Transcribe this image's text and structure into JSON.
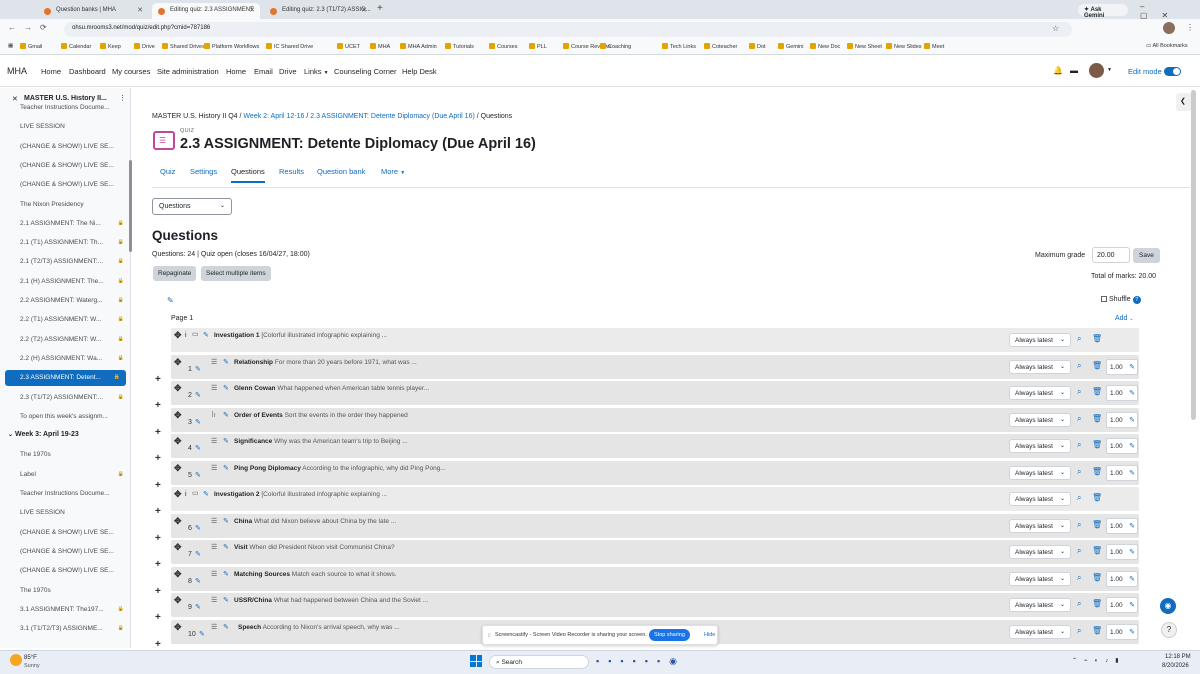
{
  "browser": {
    "tabs": [
      {
        "label": "Question banks | MHA"
      },
      {
        "label": "Editing quiz: 2.3 ASSIGNMENT"
      },
      {
        "label": "Editing quiz: 2.3 (T1/T2) ASSIG..."
      }
    ],
    "ask_gemini": "Ask Gemini",
    "url": "ohsu.mrooms3.net/mod/quiz/edit.php?cmid=787186",
    "bookmarks": [
      "Gmail",
      "Calendar",
      "Keep",
      "Drive",
      "Shared Drives",
      "Platform Workflows",
      "IC Shared Drive",
      "UCET",
      "MHA",
      "MHA Admin",
      "Tutorials",
      "Courses",
      "PLL",
      "Course Reviews",
      "Coaching",
      "Tech Links",
      "Coteacher",
      "Dot",
      "Gemini",
      "New Doc",
      "New Sheet",
      "New Slides",
      "Meet"
    ],
    "all_bookmarks": "All Bookmarks"
  },
  "nav": {
    "brand": "MHA",
    "items": [
      "Home",
      "Dashboard",
      "My courses",
      "Site administration",
      "Home",
      "Email",
      "Drive",
      "Links",
      "Counseling Corner",
      "Help Desk"
    ],
    "edit_mode": "Edit mode"
  },
  "drawer": {
    "course_title": "MASTER U.S. History II...",
    "items": [
      {
        "label": "Teacher Instructions Docume...",
        "lock": false
      },
      {
        "label": "LIVE SESSION",
        "lock": false
      },
      {
        "label": "(CHANGE & SHOW!) LIVE SE...",
        "lock": false
      },
      {
        "label": "(CHANGE & SHOW!) LIVE SE...",
        "lock": false
      },
      {
        "label": "(CHANGE & SHOW!) LIVE SE...",
        "lock": false
      },
      {
        "label": "The Nixon Presidency",
        "lock": false
      },
      {
        "label": "2.1 ASSIGNMENT: The Ni...",
        "lock": true
      },
      {
        "label": "2.1 (T1) ASSIGNMENT: Th...",
        "lock": true
      },
      {
        "label": "2.1 (T2/T3) ASSIGNMENT:...",
        "lock": true
      },
      {
        "label": "2.1 (H) ASSIGNMENT: The...",
        "lock": true
      },
      {
        "label": "2.2 ASSIGNMENT: Waterg...",
        "lock": true
      },
      {
        "label": "2.2 (T1) ASSIGNMENT: W...",
        "lock": true
      },
      {
        "label": "2.2 (T2) ASSIGNMENT: W...",
        "lock": true
      },
      {
        "label": "2.2 (H) ASSIGNMENT: Wa...",
        "lock": true
      },
      {
        "label": "2.3 ASSIGNMENT: Detent...",
        "lock": true,
        "active": true
      },
      {
        "label": "2.3 (T1/T2) ASSIGNMENT:...",
        "lock": true
      },
      {
        "label": "To open this week's assignm...",
        "lock": false
      }
    ],
    "section": "Week 3: April 19-23",
    "items2": [
      {
        "label": "The 1970s",
        "lock": false
      },
      {
        "label": "Label",
        "lock": true
      },
      {
        "label": "Teacher Instructions Docume...",
        "lock": false
      },
      {
        "label": "LIVE SESSION",
        "lock": false
      },
      {
        "label": "(CHANGE & SHOW!) LIVE SE...",
        "lock": false
      },
      {
        "label": "(CHANGE & SHOW!) LIVE SE...",
        "lock": false
      },
      {
        "label": "(CHANGE & SHOW!) LIVE SE...",
        "lock": false
      },
      {
        "label": "The 1970s",
        "lock": false
      },
      {
        "label": "3.1 ASSIGNMENT: The197...",
        "lock": true
      },
      {
        "label": "3.1 (T1/T2/T3) ASSIGNME...",
        "lock": true
      }
    ]
  },
  "breadcrumb": [
    "MASTER U.S. History II Q4",
    "Week 2: April 12-16",
    "2.3 ASSIGNMENT: Detente Diplomacy (Due April 16)",
    "Questions"
  ],
  "activity_type": "QUIZ",
  "page_title": "2.3 ASSIGNMENT: Detente Diplomacy (Due April 16)",
  "tabs": [
    "Quiz",
    "Settings",
    "Questions",
    "Results",
    "Question bank",
    "More"
  ],
  "questions_select": "Questions",
  "heading": "Questions",
  "info": "Questions: 24 | Quiz open (closes 16/04/27, 18:00)",
  "max_grade_label": "Maximum grade",
  "max_grade": "20.00",
  "save": "Save",
  "repaginate": "Repaginate",
  "select_multiple": "Select multiple items",
  "total_marks": "Total of marks: 20.00",
  "shuffle": "Shuffle",
  "page_label": "Page 1",
  "add": "Add",
  "rows": [
    {
      "num": "i",
      "type": "section",
      "title": "Investigation 1",
      "text": "[Colorful illustrated infographic explaining ...",
      "version": "Always latest",
      "mark": ""
    },
    {
      "num": "1",
      "type": "multi",
      "title": "Relationship",
      "text": "For more than 20 years before 1971, what was ...",
      "version": "Always latest",
      "mark": "1.00"
    },
    {
      "num": "2",
      "type": "multi",
      "title": "Glenn Cowan",
      "text": "What happened when American table tennis player...",
      "version": "Always latest",
      "mark": "1.00"
    },
    {
      "num": "3",
      "type": "order",
      "title": "Order of Events",
      "text": "Sort the events in the order they happened",
      "version": "Always latest",
      "mark": "1.00"
    },
    {
      "num": "4",
      "type": "multi",
      "title": "Significance",
      "text": "Why was the American team's trip to Beijing ...",
      "version": "Always latest",
      "mark": "1.00"
    },
    {
      "num": "5",
      "type": "multi",
      "title": "Ping Pong Diplomacy",
      "text": "According to the infographic, why did Ping Pong...",
      "version": "Always latest",
      "mark": "1.00"
    },
    {
      "num": "i",
      "type": "section",
      "title": "Investigation 2",
      "text": "[Colorful illustrated infographic explaining ...",
      "version": "Always latest",
      "mark": ""
    },
    {
      "num": "6",
      "type": "multi",
      "title": "China",
      "text": "What did Nixon believe about China by the late ...",
      "version": "Always latest",
      "mark": "1.00"
    },
    {
      "num": "7",
      "type": "multi",
      "title": "Visit",
      "text": "When did President Nixon visit Communist China?",
      "version": "Always latest",
      "mark": "1.00"
    },
    {
      "num": "8",
      "type": "multi",
      "title": "Matching Sources",
      "text": "Match each source to what it shows.",
      "version": "Always latest",
      "mark": "1.00"
    },
    {
      "num": "9",
      "type": "multi",
      "title": "USSR/China",
      "text": "What had happened between China and the Soviet ...",
      "version": "Always latest",
      "mark": "1.00"
    },
    {
      "num": "10",
      "type": "multi",
      "title": "Speech",
      "text": "According to Nixon's arrival speech, why was ...",
      "version": "Always latest",
      "mark": "1.00"
    }
  ],
  "share_bar": {
    "text": "Screencastify - Screen Video Recorder is sharing your screen.",
    "stop": "Stop sharing",
    "hide": "Hide"
  },
  "taskbar": {
    "temp": "85°F",
    "weather": "Sunny",
    "search": "Search",
    "time": "12:18 PM",
    "date": "8/20/2026"
  },
  "colors": {
    "accent": "#0f6cbf",
    "slot_bg": "#e5e5e5"
  }
}
